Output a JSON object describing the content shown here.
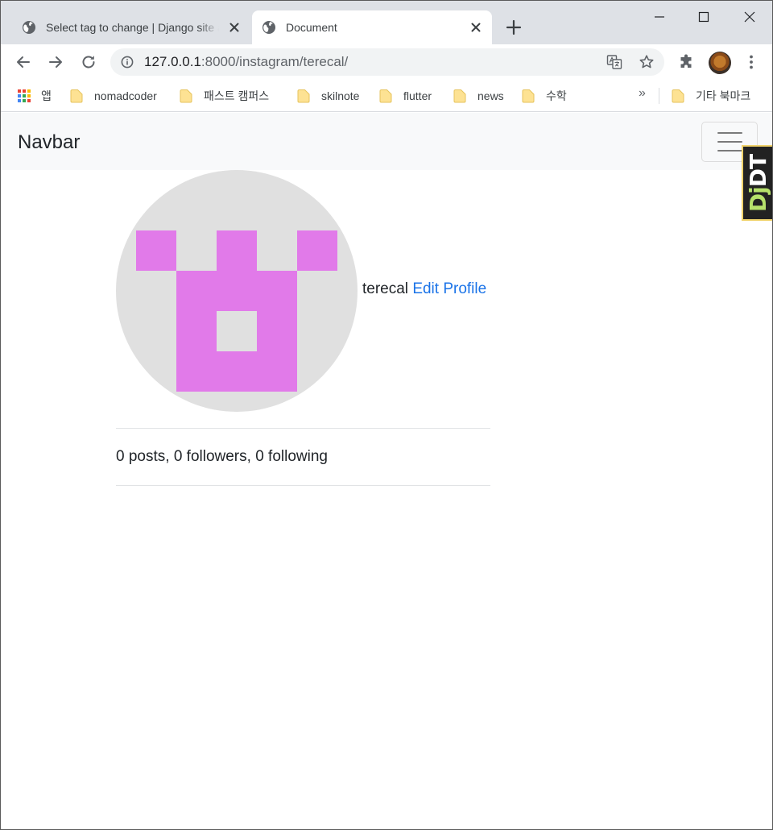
{
  "browser": {
    "tabs": [
      {
        "title": "Select tag to change | Django site admin",
        "active": false
      },
      {
        "title": "Document",
        "active": true
      }
    ],
    "address_bar": {
      "host": "127.0.0.1",
      "path": ":8000/instagram/terecal/"
    },
    "bookmarks": [
      {
        "label": "앱",
        "icon": "apps-grid-icon"
      },
      {
        "label": "nomadcoder",
        "icon": "folder-icon"
      },
      {
        "label": "패스트 캠퍼스",
        "icon": "folder-icon"
      },
      {
        "label": "skilnote",
        "icon": "folder-icon"
      },
      {
        "label": "flutter",
        "icon": "folder-icon"
      },
      {
        "label": "news",
        "icon": "folder-icon"
      },
      {
        "label": "수학",
        "icon": "folder-icon"
      }
    ],
    "bookmarks_more": "»",
    "other_bookmarks": "기타 북마크"
  },
  "page": {
    "navbar": {
      "brand": "Navbar"
    },
    "debug_toolbar": {
      "prefix": "Dj",
      "suffix": "DT"
    },
    "profile": {
      "username": "terecal",
      "edit_label": "Edit Profile",
      "avatar_color": "#e17ae9",
      "avatar_bg": "#e0e0e0",
      "stats": "0 posts, 0 followers, 0 following"
    }
  },
  "colors": {
    "tabstrip": "#dee1e6",
    "link": "#1a73e8",
    "navbar_bg": "#f8f9fa"
  }
}
